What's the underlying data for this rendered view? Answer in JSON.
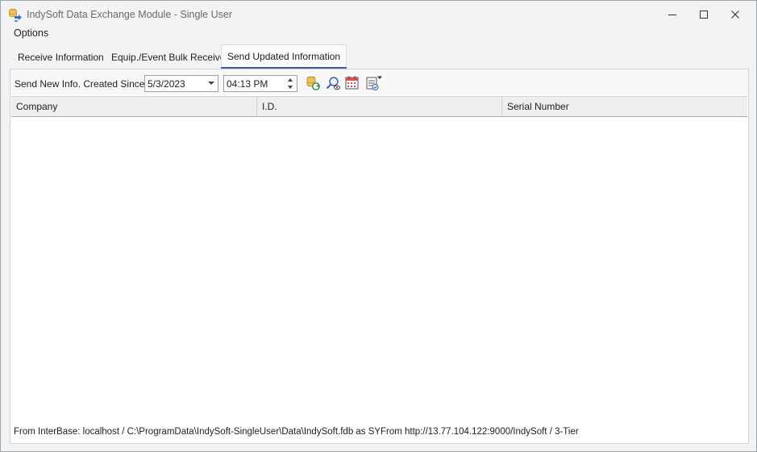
{
  "window": {
    "title": "IndySoft Data Exchange Module - Single User",
    "icon": "indysoft-app-icon",
    "controls": [
      "minimize-icon",
      "maximize-icon",
      "close-icon"
    ]
  },
  "menu": {
    "items": [
      {
        "label": "Options"
      }
    ]
  },
  "tabs": [
    {
      "label": "Receive Information",
      "active": false
    },
    {
      "label": "Equip./Event Bulk Receive",
      "active": false
    },
    {
      "label": "Send Updated Information",
      "active": true
    }
  ],
  "toolbar": {
    "label": "Send New Info. Created Since:",
    "date_value": "5/3/2023",
    "time_value": "04:13 PM",
    "buttons": [
      {
        "name": "refresh-database",
        "icon": "database-refresh-icon"
      },
      {
        "name": "preview",
        "icon": "search-preview-icon"
      },
      {
        "name": "calendar",
        "icon": "calendar-icon"
      },
      {
        "name": "checklist-options",
        "icon": "checklist-dropdown-icon"
      }
    ]
  },
  "grid": {
    "columns": [
      "Company",
      "I.D.",
      "Serial Number"
    ],
    "rows": []
  },
  "status": {
    "left": "From InterBase: localhost / C:\\ProgramData\\IndySoft-SingleUser\\Data\\IndySoft.fdb as SY:",
    "right": "From http://13.77.104.122:9000/IndySoft / 3-Tier"
  },
  "colors": {
    "accent": "#3c5f9c",
    "window_bg": "#f3f3f3",
    "header_bg": "#eeeeee"
  }
}
